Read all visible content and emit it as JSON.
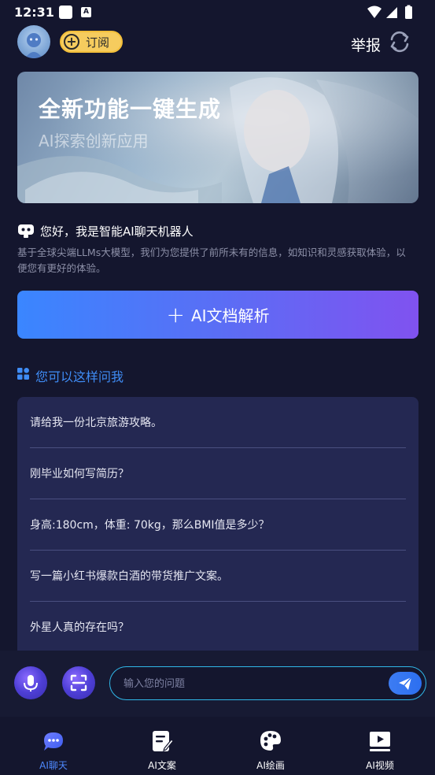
{
  "status_bar": {
    "time": "12:31",
    "notif_letter": "A"
  },
  "header": {
    "subscribe_label": "订阅",
    "report_label": "举报"
  },
  "banner": {
    "title": "全新功能一键生成",
    "subtitle": "AI探索创新应用"
  },
  "intro": {
    "title": "您好，我是智能AI聊天机器人",
    "description": "基于全球尖端LLMs大模型，我们为您提供了前所未有的信息，如知识和灵感获取体验，以便您有更好的体验。"
  },
  "doc_button": {
    "label": "AI文档解析"
  },
  "suggestions": {
    "title": "您可以这样问我",
    "items": [
      "请给我一份北京旅游攻略。",
      "刚毕业如何写简历？",
      "身高:180cm，体重: 70kg，那么BMI值是多少？",
      "写一篇小红书爆款白酒的带货推广文案。",
      "外星人真的存在吗？"
    ]
  },
  "input": {
    "placeholder": "输入您的问题",
    "value": ""
  },
  "bottom_nav": {
    "items": [
      {
        "label": "AI聊天",
        "icon": "chat-bubble-icon",
        "active": true
      },
      {
        "label": "AI文案",
        "icon": "document-edit-icon",
        "active": false
      },
      {
        "label": "AI绘画",
        "icon": "palette-icon",
        "active": false
      },
      {
        "label": "AI视频",
        "icon": "video-play-icon",
        "active": false
      }
    ]
  },
  "colors": {
    "background": "#14162e",
    "accent_blue": "#3f8cf5",
    "card": "#242852",
    "subscribe_yellow": "#f6cc5e"
  }
}
